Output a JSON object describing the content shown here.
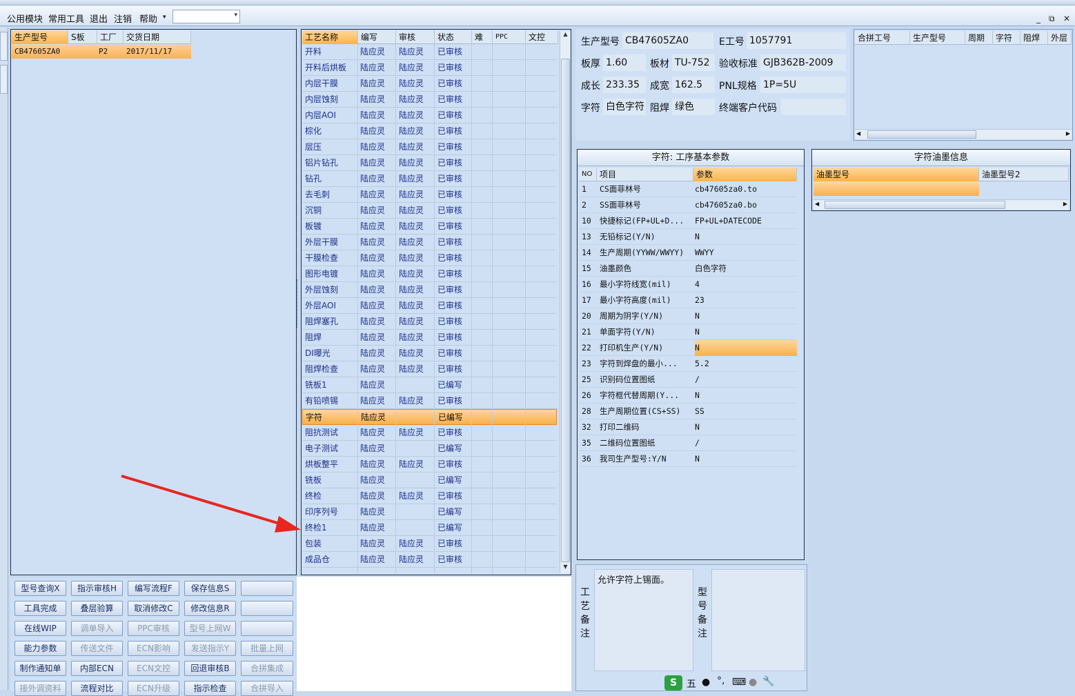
{
  "menu": [
    "公用模块",
    "常用工具",
    "退出",
    "注销",
    "帮助"
  ],
  "window_controls": [
    "_",
    "⧉",
    "✕"
  ],
  "order_grid": {
    "headers": [
      "生产型号",
      "S板",
      "工厂",
      "交货日期"
    ],
    "rows": [
      [
        "CB47605ZA0",
        "",
        "P2",
        "2017/11/17"
      ]
    ]
  },
  "process_grid": {
    "headers": [
      "工艺名称",
      "编写",
      "审核",
      "状态",
      "难",
      "PPC",
      "文控"
    ],
    "rows": [
      [
        "开料",
        "陆应灵",
        "陆应灵",
        "已审核"
      ],
      [
        "开料后烘板",
        "陆应灵",
        "陆应灵",
        "已审核"
      ],
      [
        "内层干膜",
        "陆应灵",
        "陆应灵",
        "已审核"
      ],
      [
        "内层蚀刻",
        "陆应灵",
        "陆应灵",
        "已审核"
      ],
      [
        "内层AOI",
        "陆应灵",
        "陆应灵",
        "已审核"
      ],
      [
        "棕化",
        "陆应灵",
        "陆应灵",
        "已审核"
      ],
      [
        "层压",
        "陆应灵",
        "陆应灵",
        "已审核"
      ],
      [
        "铝片钻孔",
        "陆应灵",
        "陆应灵",
        "已审核"
      ],
      [
        "钻孔",
        "陆应灵",
        "陆应灵",
        "已审核"
      ],
      [
        "去毛刺",
        "陆应灵",
        "陆应灵",
        "已审核"
      ],
      [
        "沉铜",
        "陆应灵",
        "陆应灵",
        "已审核"
      ],
      [
        "板镀",
        "陆应灵",
        "陆应灵",
        "已审核"
      ],
      [
        "外层干膜",
        "陆应灵",
        "陆应灵",
        "已审核"
      ],
      [
        "干膜检查",
        "陆应灵",
        "陆应灵",
        "已审核"
      ],
      [
        "图形电镀",
        "陆应灵",
        "陆应灵",
        "已审核"
      ],
      [
        "外层蚀刻",
        "陆应灵",
        "陆应灵",
        "已审核"
      ],
      [
        "外层AOI",
        "陆应灵",
        "陆应灵",
        "已审核"
      ],
      [
        "阻焊塞孔",
        "陆应灵",
        "陆应灵",
        "已审核"
      ],
      [
        "阻焊",
        "陆应灵",
        "陆应灵",
        "已审核"
      ],
      [
        "DI曝光",
        "陆应灵",
        "陆应灵",
        "已审核"
      ],
      [
        "阻焊检查",
        "陆应灵",
        "陆应灵",
        "已审核"
      ],
      [
        "铣板1",
        "陆应灵",
        "",
        "已编写"
      ],
      [
        "有铅喷锡",
        "陆应灵",
        "陆应灵",
        "已审核"
      ],
      [
        "字符",
        "陆应灵",
        "",
        "已编写"
      ],
      [
        "阻抗测试",
        "陆应灵",
        "陆应灵",
        "已审核"
      ],
      [
        "电子测试",
        "陆应灵",
        "",
        "已编写"
      ],
      [
        "烘板整平",
        "陆应灵",
        "陆应灵",
        "已审核"
      ],
      [
        "铣板",
        "陆应灵",
        "",
        "已编写"
      ],
      [
        "终检",
        "陆应灵",
        "陆应灵",
        "已审核"
      ],
      [
        "印序列号",
        "陆应灵",
        "",
        "已编写"
      ],
      [
        "终检1",
        "陆应灵",
        "",
        "已编写"
      ],
      [
        "包装",
        "陆应灵",
        "陆应灵",
        "已审核"
      ],
      [
        "成品仓",
        "陆应灵",
        "陆应灵",
        "已审核"
      ]
    ],
    "selected_index": 23
  },
  "buttons": [
    [
      "型号查询X",
      "指示审核H",
      "编写流程F",
      "保存信息S",
      ""
    ],
    [
      "工具完成",
      "叠层验算",
      "取消修改C",
      "修改信息R",
      ""
    ],
    [
      "在线WIP",
      "调单导入",
      "PPC审核",
      "型号上网W",
      ""
    ],
    [
      "能力参数",
      "传送文件",
      "ECN影响",
      "发送指示Y",
      "批量上网"
    ],
    [
      "制作通知单",
      "内部ECN",
      "ECN文控",
      "回退审核B",
      "合拼集成"
    ],
    [
      "接外调资料",
      "流程对比",
      "ECN升级",
      "指示检查",
      "合拼导入"
    ]
  ],
  "disabled_buttons": [
    "调单导入",
    "PPC审核",
    "型号上网W",
    "传送文件",
    "ECN影响",
    "发送指示Y",
    "批量上网",
    "ECN文控",
    "合拼集成",
    "接外调资料",
    "ECN升级",
    "合拼导入"
  ],
  "info": {
    "model_label": "生产型号",
    "model": "CB47605ZA0",
    "eno_label": "E工号",
    "eno": "1057791",
    "thick_label": "板厚",
    "thick": "1.60",
    "mat_label": "板材",
    "mat": "TU-752",
    "std_label": "验收标准",
    "std": "GJB362B-2009",
    "len_label": "成长",
    "len": "233.35",
    "wid_label": "成宽",
    "wid": "162.5",
    "pnl_label": "PNL规格",
    "pnl": "1P=5U",
    "char_label": "字符",
    "char": "白色字符",
    "mask_label": "阻焊",
    "mask": "绿色",
    "cust_label": "终端客户代码",
    "cust": ""
  },
  "merge_grid": {
    "headers": [
      "合拼工号",
      "生产型号",
      "周期",
      "字符",
      "阻焊",
      "外层"
    ]
  },
  "params": {
    "title": "字符: 工序基本参数",
    "headers": [
      "NO",
      "项目",
      "参数"
    ],
    "rows": [
      [
        "1",
        "CS面菲林号",
        "cb47605za0.to"
      ],
      [
        "2",
        "SS面菲林号",
        "cb47605za0.bo"
      ],
      [
        "10",
        "快捷标记(FP+UL+D...",
        "FP+UL+DATECODE"
      ],
      [
        "13",
        "无铅标记(Y/N)",
        "N"
      ],
      [
        "14",
        "生产周期(YYWW/WWYY)",
        "WWYY"
      ],
      [
        "15",
        "油墨颜色",
        "白色字符"
      ],
      [
        "16",
        "最小字符线宽(mil)",
        "4"
      ],
      [
        "17",
        "最小字符高度(mil)",
        "23"
      ],
      [
        "20",
        "周期为阴字(Y/N)",
        "N"
      ],
      [
        "21",
        "单面字符(Y/N)",
        "N"
      ],
      [
        "22",
        "打印机生产(Y/N)",
        "N"
      ],
      [
        "23",
        "字符到焊盘的最小...",
        "5.2"
      ],
      [
        "25",
        "识别码位置图纸",
        "/"
      ],
      [
        "26",
        "字符框代替周期(Y...",
        "N"
      ],
      [
        "28",
        "生产周期位置(CS+SS)",
        "SS"
      ],
      [
        "32",
        "打印二维码",
        "N"
      ],
      [
        "35",
        "二维码位置图纸",
        "/"
      ],
      [
        "36",
        "我司生产型号:Y/N",
        "N"
      ]
    ],
    "selected_index": 10
  },
  "ink": {
    "title": "字符油墨信息",
    "headers": [
      "油墨型号",
      "油墨型号2"
    ]
  },
  "remarks": {
    "process_label": "工艺备注",
    "process_text": "允许字符上锡面。",
    "model_label": "型号备注",
    "model_text": ""
  },
  "ime": {
    "label": "五"
  }
}
